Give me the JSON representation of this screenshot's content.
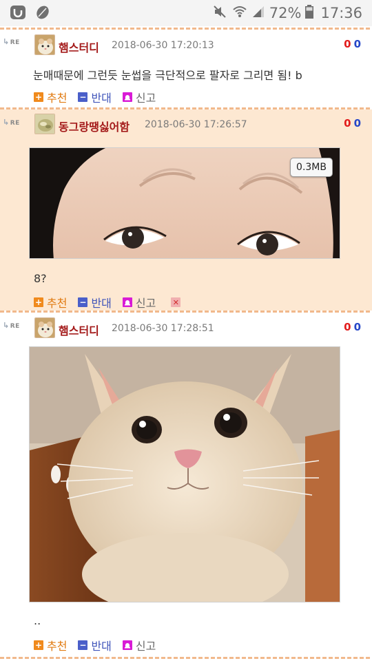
{
  "status_bar": {
    "left_icons": [
      "u-plus-icon",
      "leaf-icon"
    ],
    "battery_percent": "72%",
    "time": "17:36",
    "right_icons": [
      "mute-icon",
      "wifi-icon",
      "signal-icon",
      "battery-icon"
    ]
  },
  "re_label": "RE",
  "actions": {
    "recommend": "추천",
    "oppose": "반대",
    "report": "신고"
  },
  "comments": [
    {
      "nickname": "햄스터디",
      "date": "2018-06-30 17:20:13",
      "votes_up": "0",
      "votes_down": "0",
      "text": "눈매때문에 그런듯 눈썹을 극단적으로 팔자로 그리면 됨! b",
      "highlighted": false
    },
    {
      "nickname": "동그랑땡싫어함",
      "date": "2018-06-30 17:26:57",
      "votes_up": "0",
      "votes_down": "0",
      "image_size": "0.3MB",
      "text": "8?",
      "highlighted": true,
      "has_delete": true
    },
    {
      "nickname": "햄스터디",
      "date": "2018-06-30 17:28:51",
      "votes_up": "0",
      "votes_down": "0",
      "text": "..",
      "highlighted": false
    }
  ]
}
